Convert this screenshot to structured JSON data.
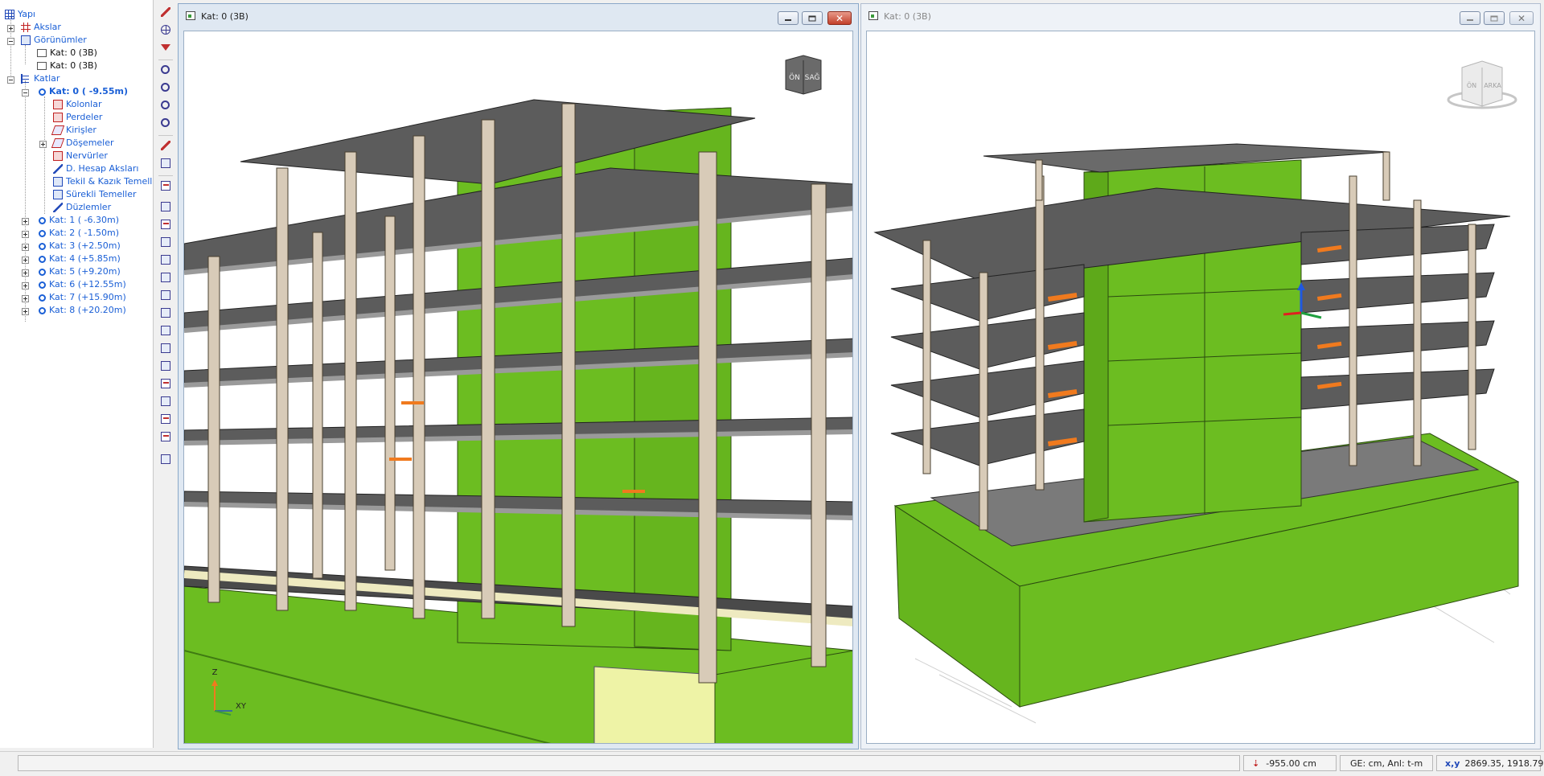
{
  "tree": {
    "root": "Yapı",
    "axes": "Akslar",
    "views": "Görünümler",
    "view_items": [
      "Kat: 0 (3B)",
      "Kat: 0 (3B)"
    ],
    "floors_label": "Katlar",
    "current_floor": "Kat: 0 ( -9.55m)",
    "floor_children": [
      "Kolonlar",
      "Perdeler",
      "Kirişler",
      "Döşemeler",
      "Nervürler",
      "D. Hesap Aksları",
      "Tekil & Kazık Temeller",
      "Sürekli Temeller",
      "Düzlemler"
    ],
    "other_floors": [
      "Kat: 1 ( -6.30m)",
      "Kat: 2 ( -1.50m)",
      "Kat: 3 (+2.50m)",
      "Kat: 4 (+5.85m)",
      "Kat: 5 (+9.20m)",
      "Kat: 6 (+12.55m)",
      "Kat: 7 (+15.90m)",
      "Kat: 8 (+20.20m)"
    ]
  },
  "viewport_left": {
    "title": "Kat: 0 (3B)",
    "cube_labels": [
      "ÖN",
      "SAĞ"
    ],
    "axis_labels": [
      "Z",
      "XY"
    ]
  },
  "viewport_right": {
    "title": "Kat: 0 (3B)",
    "cube_labels": [
      "ÖN",
      "ARKA"
    ]
  },
  "status": {
    "elevation": "-955.00 cm",
    "units": "GE: cm,  Anl: t-m",
    "coords_label": "x,y",
    "coords": "2869.35, 1918.79"
  },
  "colors": {
    "shear_wall": "#6cbd21",
    "slab": "#595959",
    "column": "#d8cbb8",
    "beam": "#f3f1cf",
    "accent_orange": "#f07a1e",
    "tree_text": "#1a5fd6"
  },
  "icons": [
    "yapi-icon",
    "akslar-icon",
    "views-icon",
    "floors-icon",
    "floor-gear-icon",
    "zoom-icon",
    "orbit-icon",
    "pencil-icon",
    "globe-icon",
    "view-cube",
    "axis-triad-icon",
    "elevation-icon",
    "coords-icon"
  ]
}
